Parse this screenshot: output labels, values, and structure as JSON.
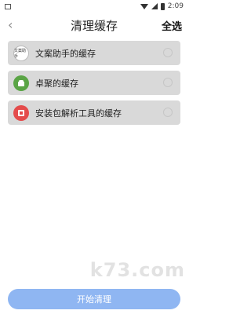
{
  "status_bar": {
    "time": "2:09"
  },
  "header": {
    "title": "清理缓存",
    "select_all": "全选",
    "back_icon": "chevron-left-icon"
  },
  "items": [
    {
      "label": "文案助手的缓存",
      "icon": "wenan-app-icon",
      "icon_text": "文案助手"
    },
    {
      "label": "卓聚的缓存",
      "icon": "android-icon"
    },
    {
      "label": "安装包解析工具的缓存",
      "icon": "apk-icon"
    }
  ],
  "footer": {
    "button_label": "开始清理"
  },
  "watermark": "​k​7​3​.com"
}
